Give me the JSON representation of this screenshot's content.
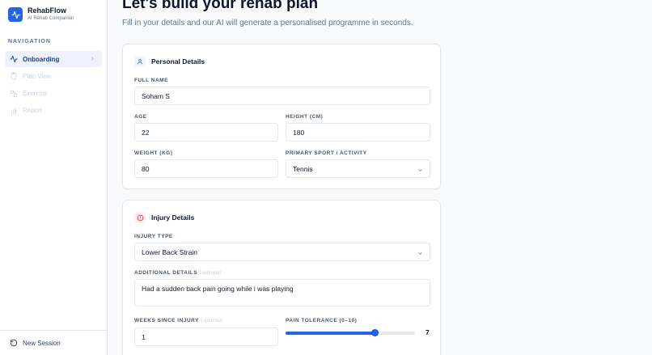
{
  "brand": {
    "name": "RehabFlow",
    "subtitle": "AI Rehab Companion",
    "color": "#2563eb"
  },
  "sidebar": {
    "heading": "NAVIGATION",
    "items": [
      {
        "label": "Onboarding",
        "icon": "activity-icon",
        "active": true
      },
      {
        "label": "Plan View",
        "icon": "clipboard-icon",
        "active": false
      },
      {
        "label": "Exercise",
        "icon": "exercise-icon",
        "active": false
      },
      {
        "label": "Report",
        "icon": "bar-chart-icon",
        "active": false
      }
    ],
    "footer_label": "New Session"
  },
  "main": {
    "title": "Let's build your rehab plan",
    "subtitle": "Fill in your details and our AI will generate a personalised programme in seconds."
  },
  "personal": {
    "title": "Personal Details",
    "full_name_label": "FULL NAME",
    "full_name_value": "Soham S",
    "age_label": "AGE",
    "age_value": "22",
    "height_label": "HEIGHT (CM)",
    "height_value": "180",
    "weight_label": "WEIGHT (KG)",
    "weight_value": "80",
    "sport_label": "PRIMARY SPORT / ACTIVITY",
    "sport_value": "Tennis"
  },
  "injury": {
    "title": "Injury Details",
    "type_label": "INJURY TYPE",
    "type_value": "Lower Back Strain",
    "details_label": "ADDITIONAL DETAILS",
    "details_optional": "(optional)",
    "details_value": "Had a sudden back pain going while i was playing",
    "weeks_label": "WEEKS SINCE INJURY",
    "weeks_optional": "(optional)",
    "weeks_value": "1",
    "pain_label": "PAIN TOLERANCE (0–10)",
    "pain_value": 7,
    "pain_min": 0,
    "pain_max": 10
  }
}
